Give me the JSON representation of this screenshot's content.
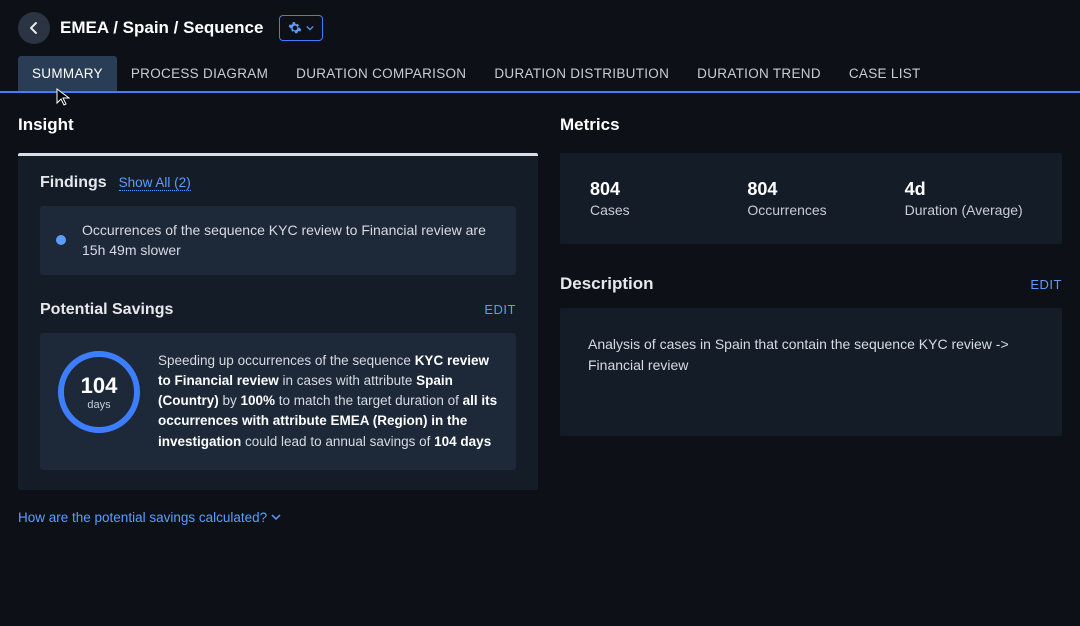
{
  "header": {
    "breadcrumb": "EMEA / Spain / Sequence"
  },
  "tabs": [
    {
      "label": "SUMMARY",
      "active": true
    },
    {
      "label": "PROCESS DIAGRAM",
      "active": false
    },
    {
      "label": "DURATION COMPARISON",
      "active": false
    },
    {
      "label": "DURATION DISTRIBUTION",
      "active": false
    },
    {
      "label": "DURATION TREND",
      "active": false
    },
    {
      "label": "CASE LIST",
      "active": false
    }
  ],
  "insight": {
    "title": "Insight",
    "findings": {
      "label": "Findings",
      "show_all": "Show All (2)",
      "items": [
        {
          "text": "Occurrences of the sequence KYC review to Financial review are 15h 49m slower"
        }
      ]
    },
    "potential_savings": {
      "label": "Potential Savings",
      "edit": "EDIT",
      "ring_value": "104",
      "ring_unit": "days",
      "text_parts": {
        "t1": "Speeding up occurrences of the sequence ",
        "b1": "KYC review to Financial review",
        "t2": " in cases with attribute ",
        "b2": "Spain (Country)",
        "t3": " by ",
        "b3": "100%",
        "t4": " to match the target duration of ",
        "b4": "all its occurrences with attribute EMEA (Region) in the investigation",
        "t5": " could lead to annual savings of ",
        "b5": "104 days"
      }
    },
    "how_link": "How are the potential savings calculated?"
  },
  "metrics": {
    "title": "Metrics",
    "items": [
      {
        "value": "804",
        "label": "Cases"
      },
      {
        "value": "804",
        "label": "Occurrences"
      },
      {
        "value": "4d",
        "label": "Duration (Average)"
      }
    ]
  },
  "description": {
    "title": "Description",
    "edit": "EDIT",
    "text": "Analysis of cases in Spain that contain the sequence KYC review -> Financial review"
  }
}
